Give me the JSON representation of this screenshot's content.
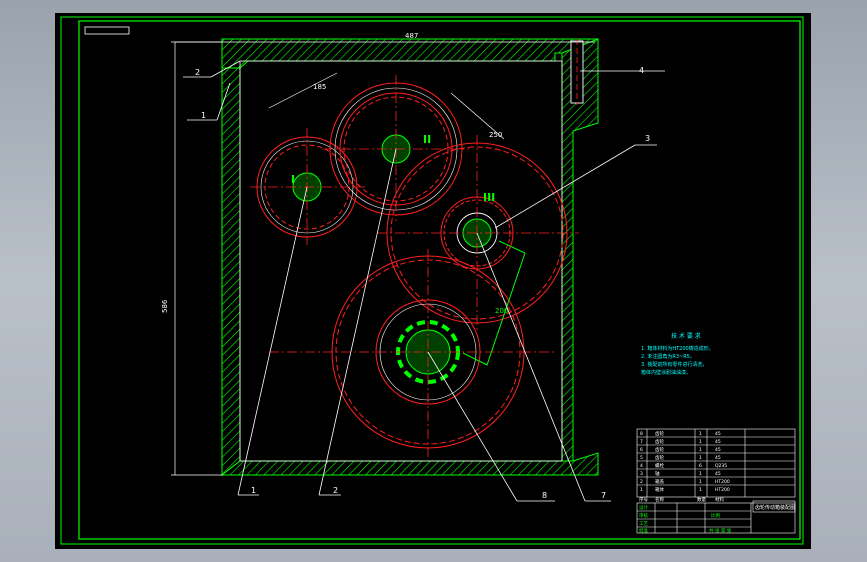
{
  "labels": {
    "top_dim": "487",
    "side_dim": "586",
    "diag_dim_top": "185",
    "diag_dim_right": "250",
    "diag_dim_lower": "200",
    "shaft_I": "I",
    "shaft_II": "II",
    "shaft_III": "III",
    "callouts": {
      "c1_left": "1",
      "c2_left": "2",
      "c3_right": "3",
      "c4_right": "4",
      "c1_bottom": "1",
      "c2_bottom": "2",
      "c8_bottom": "8",
      "c7_bottom": "7"
    }
  },
  "notes": {
    "title": "技 术 要 求",
    "lines": [
      "1. 箱体材料为HT200铸造成形。",
      "2. 未注圆角为R3~R5。",
      "3. 装配前所有零件进行清洗，",
      "   箱体内壁涂耐油油漆。"
    ]
  },
  "bom": {
    "rows": [
      [
        "8",
        "齿轮",
        "1",
        "45"
      ],
      [
        "7",
        "齿轮",
        "1",
        "45"
      ],
      [
        "6",
        "齿轮",
        "1",
        "45"
      ],
      [
        "5",
        "齿轮",
        "1",
        "45"
      ],
      [
        "4",
        "螺栓",
        "6",
        "Q235"
      ],
      [
        "3",
        "轴",
        "1",
        "45"
      ],
      [
        "2",
        "箱盖",
        "1",
        "HT200"
      ],
      [
        "1",
        "箱体",
        "1",
        "HT200"
      ]
    ],
    "header": [
      "序号",
      "名称",
      "数量",
      "材料"
    ]
  },
  "title_block": {
    "drawing_name": "齿轮传动箱装配图",
    "row_labels": [
      "设计",
      "审核",
      "工艺",
      "批准"
    ],
    "scale_label": "比例",
    "sheet_label": "共 张 第 张"
  },
  "colors": {
    "frame": "#00ff00",
    "gear": "#ff2020",
    "centerline": "#ff2020",
    "annotation": "#ffffff",
    "shaft": "#00ff00"
  }
}
